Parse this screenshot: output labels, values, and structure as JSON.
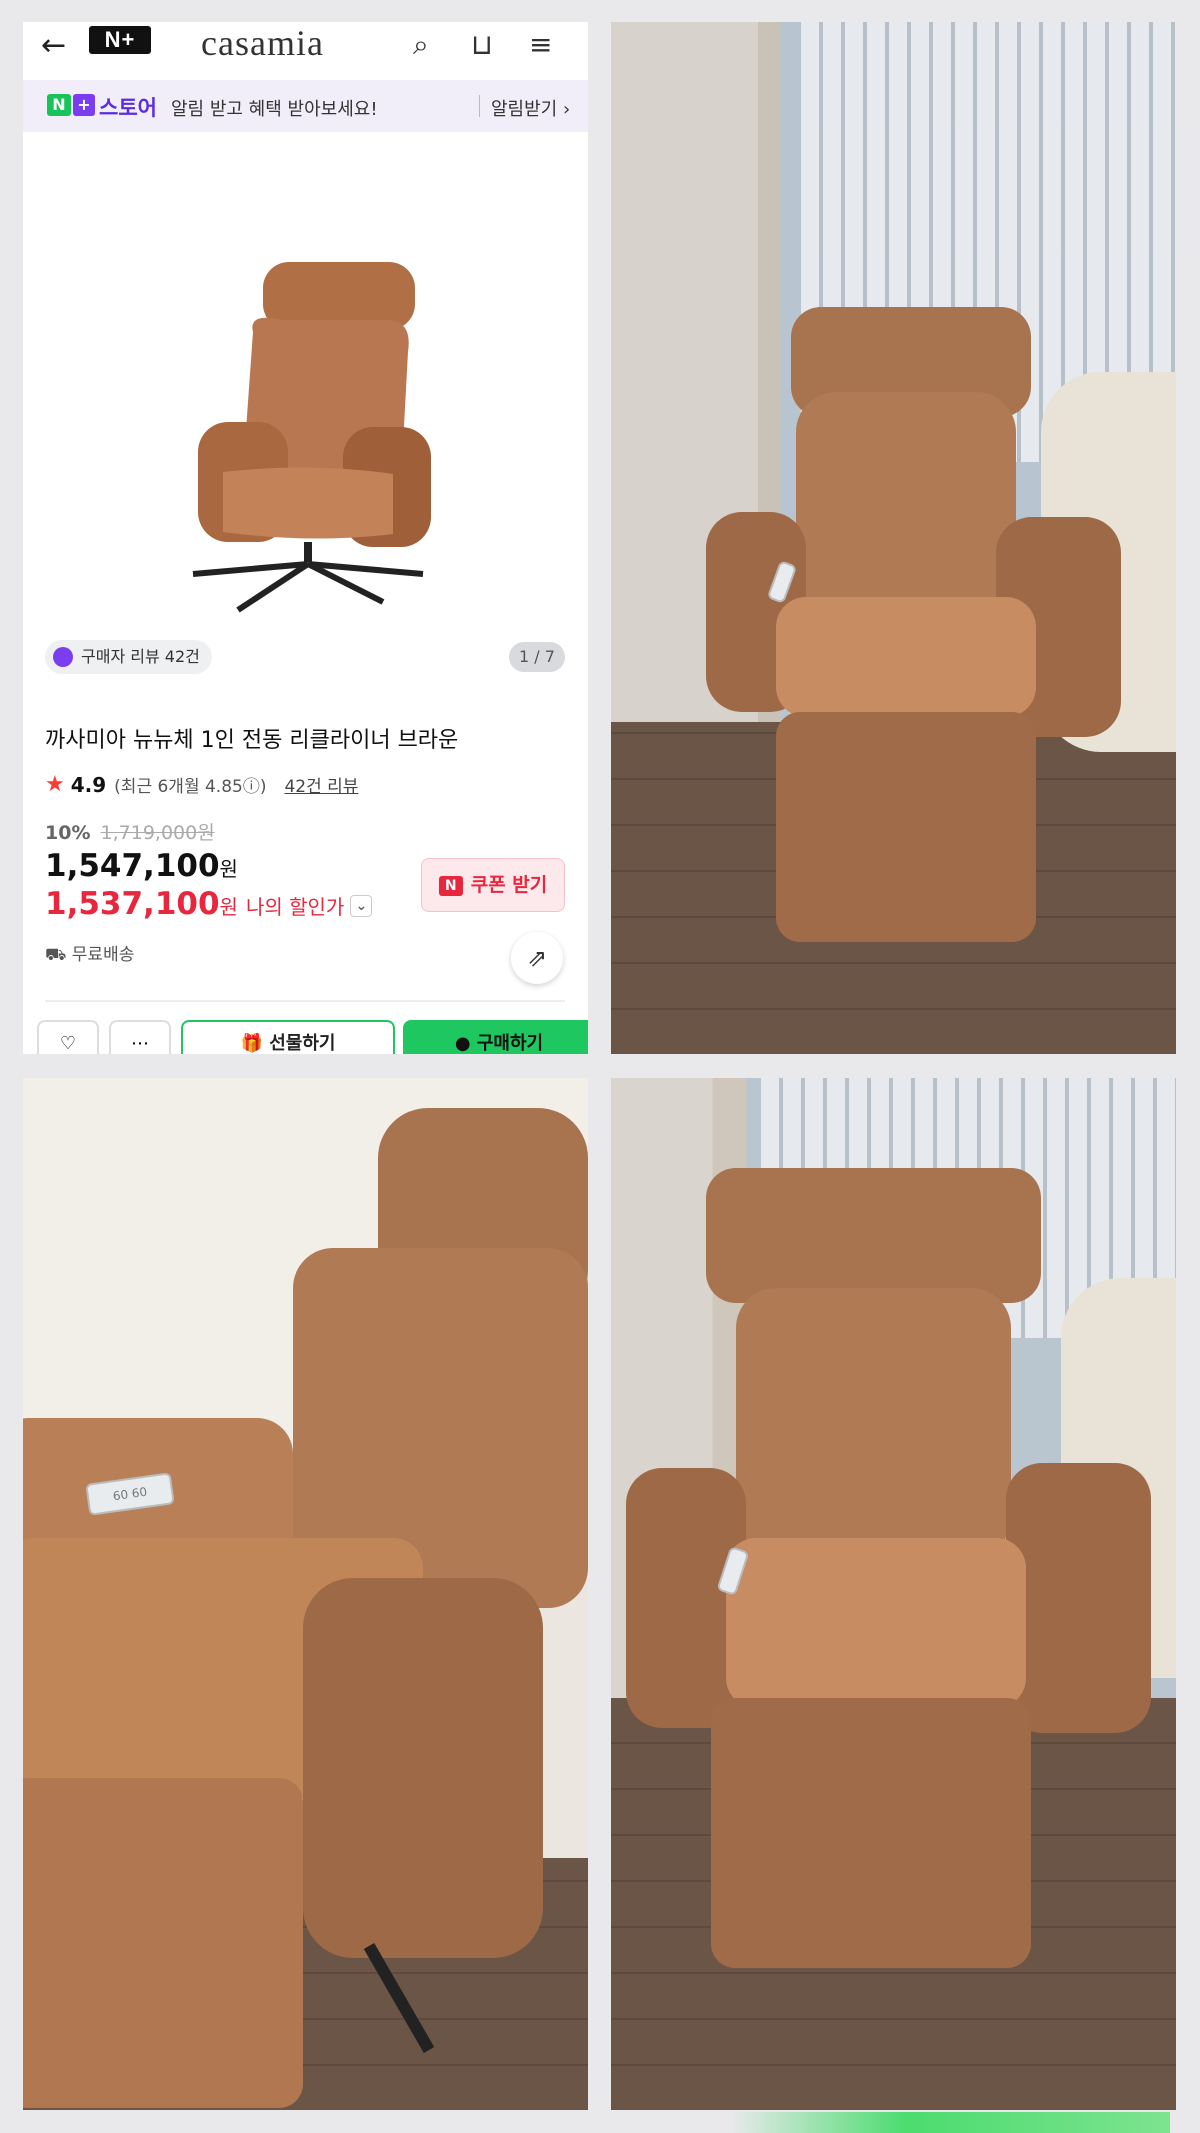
{
  "store_screen": {
    "brand": "casamia",
    "nplus_label": "N+",
    "notice": {
      "store_label": "스토어",
      "message": "알림 받고 혜택 받아보세요!",
      "action": "알림받기 ›"
    },
    "review_chip": "구매자 리뷰 42건",
    "pager": "1 / 7",
    "product_title": "까사미아 뉴뉴체 1인 전동 리클라이너 브라운",
    "rating": {
      "score": "4.9",
      "recent": "(최근 6개월 4.85ⓘ)",
      "reviews_link": "42건 리뷰"
    },
    "discount_pct": "10%",
    "original_price": "1,719,000원",
    "price": "1,547,100",
    "my_price": "1,537,100",
    "currency": "원",
    "my_discount_label": "나의 할인가",
    "coupon_label": "쿠폰 받기",
    "shipping": "무료배송",
    "actions": {
      "gift": "선물하기",
      "buy": "구매하기"
    }
  },
  "remote_labels": {
    "bottom_left": "60 60"
  },
  "colors": {
    "accent_green": "#1ec75f",
    "price_red": "#e8263d",
    "leather": "#b07a55"
  }
}
